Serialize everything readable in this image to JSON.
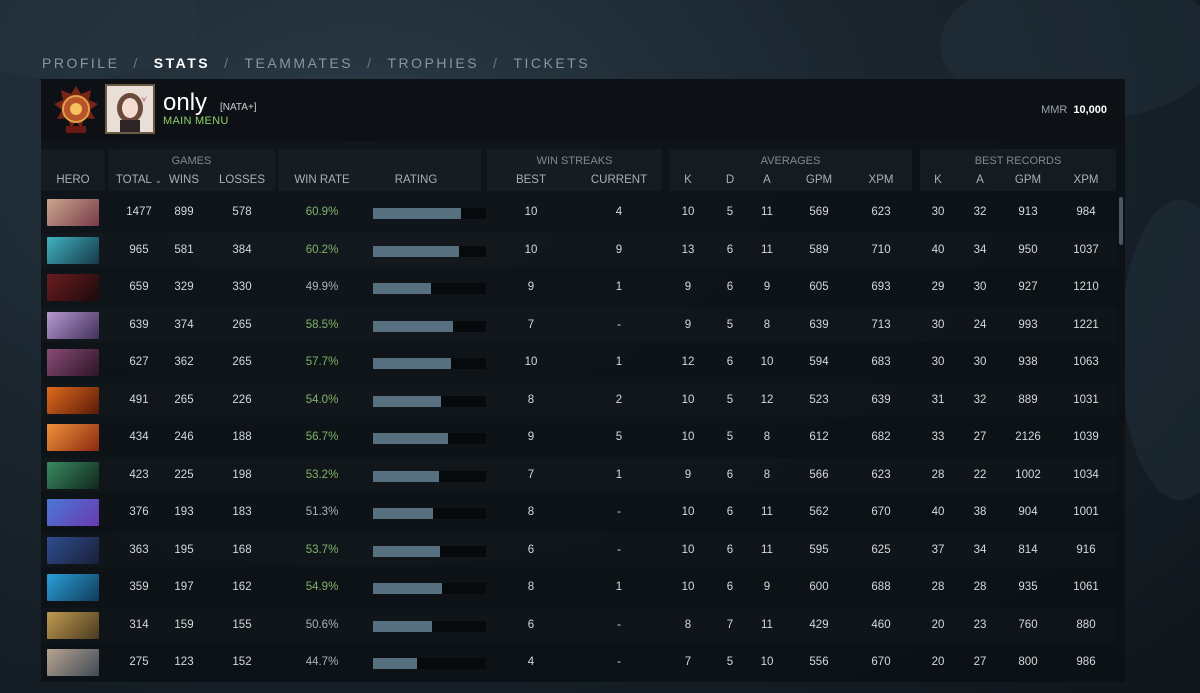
{
  "nav": {
    "tabs": [
      "PROFILE",
      "STATS",
      "TEAMMATES",
      "TROPHIES",
      "TICKETS"
    ],
    "active": 1,
    "separator": "/"
  },
  "player": {
    "name": "only",
    "tag": "[NATA+]",
    "subtitle": "MAIN MENU",
    "medal_icon": "immortal-rank-medal-icon",
    "mmr_label": "MMR",
    "mmr_value": "10,000"
  },
  "headers": {
    "hero": "HERO",
    "games_group": "GAMES",
    "total": "TOTAL",
    "total_sort_icon": "chevron-down-icon",
    "wins": "WINS",
    "losses": "LOSSES",
    "win_rate": "WIN RATE",
    "rating": "RATING",
    "streaks_group": "WIN STREAKS",
    "best": "BEST",
    "current": "CURRENT",
    "averages_group": "AVERAGES",
    "k": "K",
    "d": "D",
    "a": "A",
    "gpm": "GPM",
    "xpm": "XPM",
    "records_group": "BEST RECORDS",
    "rk": "K",
    "ra": "A",
    "rgpm": "GPM",
    "rxpm": "XPM"
  },
  "colors": {
    "accent_green": "#7fb36a",
    "rating_bar": "#56707f",
    "panel_bg": "#0c1014"
  },
  "rows": [
    {
      "hero_color": [
        "#c9a78f",
        "#7a3a48"
      ],
      "total": "1477",
      "wins": "899",
      "losses": "578",
      "win_rate": "60.9%",
      "rating": 0.78,
      "best": "10",
      "current": "4",
      "k": "10",
      "d": "5",
      "a": "11",
      "gpm": "569",
      "xpm": "623",
      "rk": "30",
      "ra": "32",
      "rgpm": "913",
      "rxpm": "984"
    },
    {
      "hero_color": [
        "#3fb3c2",
        "#173847"
      ],
      "total": "965",
      "wins": "581",
      "losses": "384",
      "win_rate": "60.2%",
      "rating": 0.76,
      "best": "10",
      "current": "9",
      "k": "13",
      "d": "6",
      "a": "11",
      "gpm": "589",
      "xpm": "710",
      "rk": "40",
      "ra": "34",
      "rgpm": "950",
      "rxpm": "1037"
    },
    {
      "hero_color": [
        "#6a1c1f",
        "#1c0a0c"
      ],
      "total": "659",
      "wins": "329",
      "losses": "330",
      "win_rate": "49.9%",
      "rating": 0.51,
      "best": "9",
      "current": "1",
      "k": "9",
      "d": "6",
      "a": "9",
      "gpm": "605",
      "xpm": "693",
      "rk": "29",
      "ra": "30",
      "rgpm": "927",
      "rxpm": "1210"
    },
    {
      "hero_color": [
        "#b79ad3",
        "#42305a"
      ],
      "total": "639",
      "wins": "374",
      "losses": "265",
      "win_rate": "58.5%",
      "rating": 0.71,
      "best": "7",
      "current": "-",
      "k": "9",
      "d": "5",
      "a": "8",
      "gpm": "639",
      "xpm": "713",
      "rk": "30",
      "ra": "24",
      "rgpm": "993",
      "rxpm": "1221"
    },
    {
      "hero_color": [
        "#8a4b76",
        "#2c1526"
      ],
      "total": "627",
      "wins": "362",
      "losses": "265",
      "win_rate": "57.7%",
      "rating": 0.69,
      "best": "10",
      "current": "1",
      "k": "12",
      "d": "6",
      "a": "10",
      "gpm": "594",
      "xpm": "683",
      "rk": "30",
      "ra": "30",
      "rgpm": "938",
      "rxpm": "1063"
    },
    {
      "hero_color": [
        "#e06a1e",
        "#5a1a08"
      ],
      "total": "491",
      "wins": "265",
      "losses": "226",
      "win_rate": "54.0%",
      "rating": 0.6,
      "best": "8",
      "current": "2",
      "k": "10",
      "d": "5",
      "a": "12",
      "gpm": "523",
      "xpm": "639",
      "rk": "31",
      "ra": "32",
      "rgpm": "889",
      "rxpm": "1031"
    },
    {
      "hero_color": [
        "#f0923a",
        "#8a2a10"
      ],
      "total": "434",
      "wins": "246",
      "losses": "188",
      "win_rate": "56.7%",
      "rating": 0.66,
      "best": "9",
      "current": "5",
      "k": "10",
      "d": "5",
      "a": "8",
      "gpm": "612",
      "xpm": "682",
      "rk": "33",
      "ra": "27",
      "rgpm": "2126",
      "rxpm": "1039"
    },
    {
      "hero_color": [
        "#3a8a62",
        "#10281c"
      ],
      "total": "423",
      "wins": "225",
      "losses": "198",
      "win_rate": "53.2%",
      "rating": 0.58,
      "best": "7",
      "current": "1",
      "k": "9",
      "d": "6",
      "a": "8",
      "gpm": "566",
      "xpm": "623",
      "rk": "28",
      "ra": "22",
      "rgpm": "1002",
      "rxpm": "1034"
    },
    {
      "hero_color": [
        "#4a78d6",
        "#6a3ab0"
      ],
      "total": "376",
      "wins": "193",
      "losses": "183",
      "win_rate": "51.3%",
      "rating": 0.53,
      "best": "8",
      "current": "-",
      "k": "10",
      "d": "6",
      "a": "11",
      "gpm": "562",
      "xpm": "670",
      "rk": "40",
      "ra": "38",
      "rgpm": "904",
      "rxpm": "1001"
    },
    {
      "hero_color": [
        "#2e4e8e",
        "#1a1f3a"
      ],
      "total": "363",
      "wins": "195",
      "losses": "168",
      "win_rate": "53.7%",
      "rating": 0.59,
      "best": "6",
      "current": "-",
      "k": "10",
      "d": "6",
      "a": "11",
      "gpm": "595",
      "xpm": "625",
      "rk": "37",
      "ra": "34",
      "rgpm": "814",
      "rxpm": "916"
    },
    {
      "hero_color": [
        "#2aa0d8",
        "#123a5a"
      ],
      "total": "359",
      "wins": "197",
      "losses": "162",
      "win_rate": "54.9%",
      "rating": 0.61,
      "best": "8",
      "current": "1",
      "k": "10",
      "d": "6",
      "a": "9",
      "gpm": "600",
      "xpm": "688",
      "rk": "28",
      "ra": "28",
      "rgpm": "935",
      "rxpm": "1061"
    },
    {
      "hero_color": [
        "#c09a52",
        "#4a3a1e"
      ],
      "total": "314",
      "wins": "159",
      "losses": "155",
      "win_rate": "50.6%",
      "rating": 0.52,
      "best": "6",
      "current": "-",
      "k": "8",
      "d": "7",
      "a": "11",
      "gpm": "429",
      "xpm": "460",
      "rk": "20",
      "ra": "23",
      "rgpm": "760",
      "rxpm": "880"
    },
    {
      "hero_color": [
        "#b8a490",
        "#3e4a56"
      ],
      "total": "275",
      "wins": "123",
      "losses": "152",
      "win_rate": "44.7%",
      "rating": 0.39,
      "best": "4",
      "current": "-",
      "k": "7",
      "d": "5",
      "a": "10",
      "gpm": "556",
      "xpm": "670",
      "rk": "20",
      "ra": "27",
      "rgpm": "800",
      "rxpm": "986"
    }
  ]
}
